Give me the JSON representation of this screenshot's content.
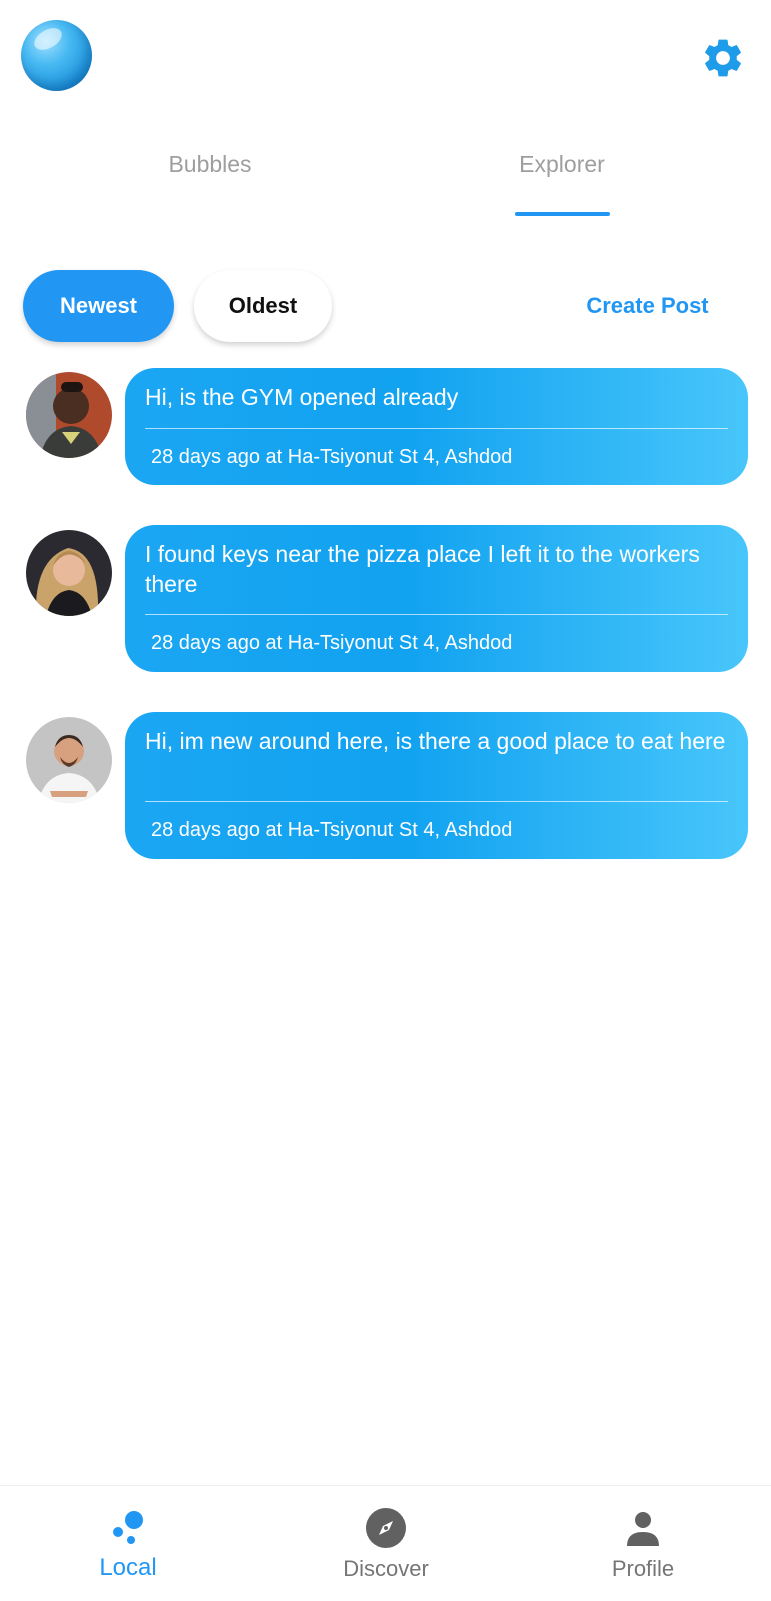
{
  "header": {
    "logo_icon": "bubble-logo-icon",
    "settings_icon": "gear-icon"
  },
  "tabs": [
    {
      "label": "Bubbles",
      "active": false
    },
    {
      "label": "Explorer",
      "active": true
    }
  ],
  "sort": {
    "newest_label": "Newest",
    "oldest_label": "Oldest",
    "selected": "Newest"
  },
  "create_post_label": "Create Post",
  "posts": [
    {
      "text": "Hi, is the GYM opened already",
      "meta": "28 days ago at Ha-Tsiyonut St 4, Ashdod"
    },
    {
      "text": "I found keys near the pizza place I left it to the workers there",
      "meta": "28 days ago at Ha-Tsiyonut St 4, Ashdod"
    },
    {
      "text": "Hi, im new around here, is there a good place to eat here",
      "meta": "28 days ago at Ha-Tsiyonut St 4, Ashdod"
    }
  ],
  "bottom_nav": [
    {
      "label": "Local",
      "icon": "bubbles-icon",
      "active": true
    },
    {
      "label": "Discover",
      "icon": "compass-icon",
      "active": false
    },
    {
      "label": "Profile",
      "icon": "person-icon",
      "active": false
    }
  ],
  "colors": {
    "accent": "#2196f3",
    "bubble_start": "#1ba6f2",
    "bubble_end": "#48c6fb",
    "inactive": "#757575"
  }
}
